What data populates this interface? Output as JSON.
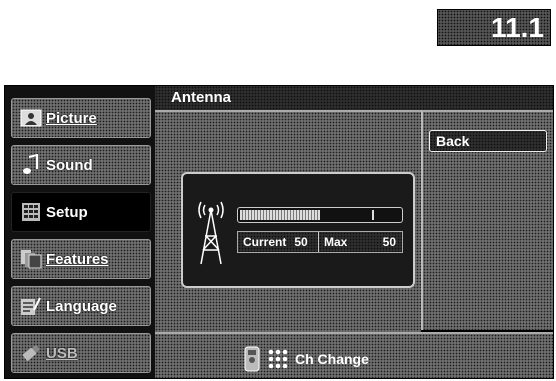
{
  "page_number": "11.1",
  "sidebar": {
    "items": [
      {
        "label": "Picture",
        "icon": "picture-icon"
      },
      {
        "label": "Sound",
        "icon": "music-note-icon"
      },
      {
        "label": "Setup",
        "icon": "setup-grid-icon"
      },
      {
        "label": "Features",
        "icon": "features-icon"
      },
      {
        "label": "Language",
        "icon": "language-icon"
      },
      {
        "label": "USB",
        "icon": "usb-icon"
      }
    ],
    "selected": "Setup"
  },
  "main": {
    "title": "Antenna",
    "back_label": "Back",
    "signal": {
      "current_label": "Current",
      "current_value": "50",
      "max_label": "Max",
      "max_value": "50",
      "level_fraction": 0.5
    },
    "footer_hint": "Ch Change"
  }
}
